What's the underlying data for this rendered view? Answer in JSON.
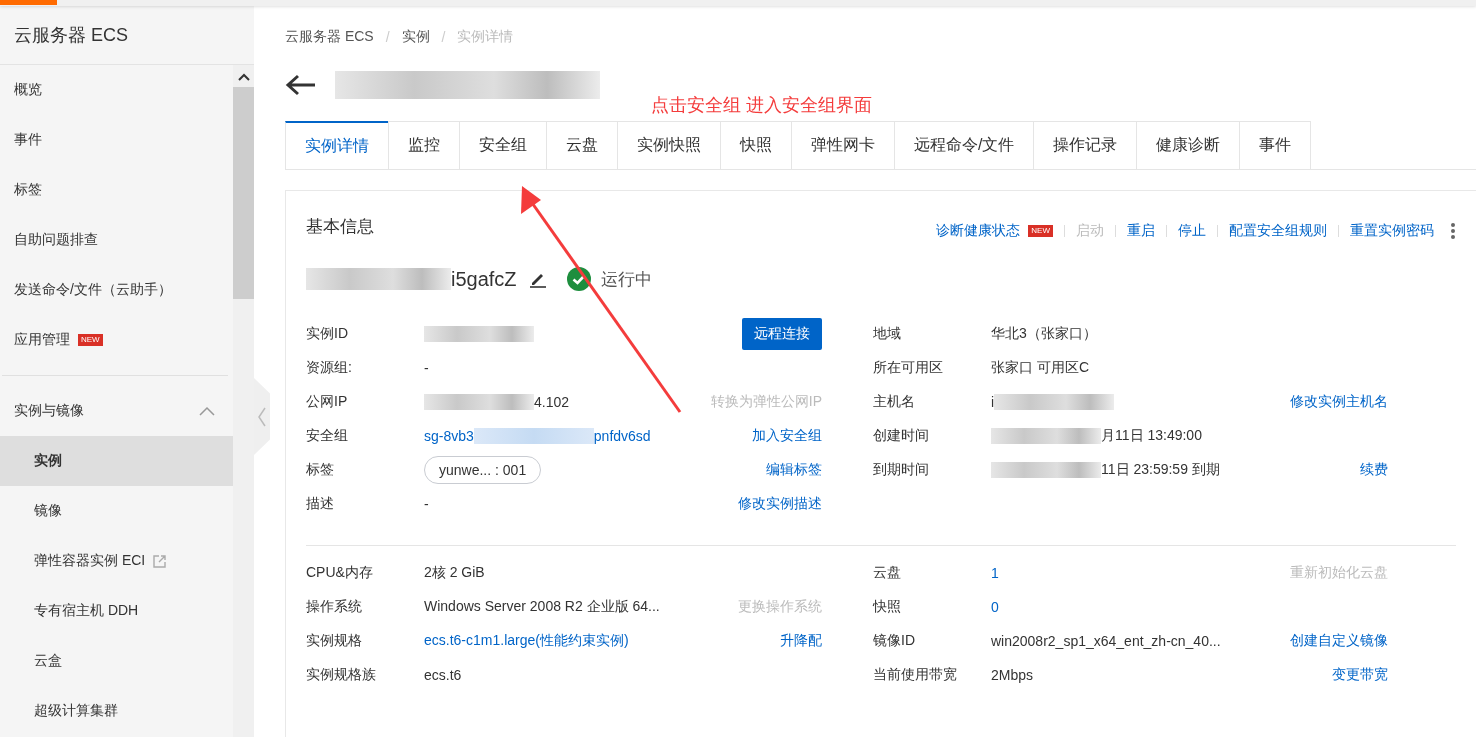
{
  "sidebar": {
    "title": "云服务器 ECS",
    "items": [
      {
        "label": "概览",
        "selected": false
      },
      {
        "label": "事件",
        "selected": false
      },
      {
        "label": "标签",
        "selected": false
      },
      {
        "label": "自助问题排查",
        "selected": false
      },
      {
        "label": "发送命令/文件（云助手）",
        "selected": false
      },
      {
        "label": "应用管理",
        "selected": false,
        "badge": "NEW"
      }
    ],
    "groups": [
      {
        "label": "实例与镜像",
        "expanded": true,
        "children": [
          {
            "label": "实例",
            "selected": true
          },
          {
            "label": "镜像",
            "selected": false
          },
          {
            "label": "弹性容器实例 ECI",
            "selected": false,
            "external": true
          },
          {
            "label": "专有宿主机 DDH",
            "selected": false
          },
          {
            "label": "云盒",
            "selected": false
          },
          {
            "label": "超级计算集群",
            "selected": false
          }
        ]
      }
    ]
  },
  "breadcrumb": [
    {
      "label": "云服务器 ECS",
      "current": false
    },
    {
      "separator": "/",
      "label": "实例",
      "current": false
    },
    {
      "separator": "/",
      "label": "实例详情",
      "current": true
    }
  ],
  "annotation": {
    "text": "点击安全组 进入安全组界面"
  },
  "tabs": [
    {
      "label": "实例详情",
      "selected": true
    },
    {
      "label": "监控",
      "selected": false
    },
    {
      "label": "安全组",
      "selected": false
    },
    {
      "label": "云盘",
      "selected": false
    },
    {
      "label": "实例快照",
      "selected": false
    },
    {
      "label": "快照",
      "selected": false
    },
    {
      "label": "弹性网卡",
      "selected": false
    },
    {
      "label": "远程命令/文件",
      "selected": false
    },
    {
      "label": "操作记录",
      "selected": false
    },
    {
      "label": "健康诊断",
      "selected": false
    },
    {
      "label": "事件",
      "selected": false
    }
  ],
  "basic_info": {
    "title": "基本信息",
    "actions": [
      {
        "label": "诊断健康状态",
        "badge": "NEW",
        "disabled": false
      },
      {
        "label": "启动",
        "disabled": true
      },
      {
        "label": "重启",
        "disabled": false
      },
      {
        "label": "停止",
        "disabled": false
      },
      {
        "label": "配置安全组规则",
        "disabled": false
      },
      {
        "label": "重置实例密码",
        "disabled": false
      }
    ],
    "instance_name": "i5gafcZ",
    "status": "运行中",
    "sections": [
      {
        "rows": [
          {
            "label": "实例ID",
            "value": [
              {
                "kind": "blur"
              }
            ],
            "kind": "text",
            "action": {
              "label": "远程连接",
              "kind": "button",
              "disabled": false
            }
          },
          {
            "label": "地域",
            "value": [
              {
                "kind": "text",
                "text": "华北3（张家口）"
              }
            ],
            "kind": "text"
          },
          {
            "label": "资源组:",
            "value": [
              {
                "kind": "text",
                "text": "-"
              }
            ],
            "kind": "text"
          },
          {
            "label": "所在可用区",
            "value": [
              {
                "kind": "text",
                "text": "张家口 可用区C"
              }
            ],
            "kind": "text"
          },
          {
            "label": "公网IP",
            "value": [
              {
                "kind": "blur"
              },
              {
                "kind": "text",
                "text": "4.102"
              }
            ],
            "kind": "text",
            "action": {
              "label": "转换为弹性公网IP",
              "kind": "link",
              "disabled": true
            }
          },
          {
            "label": "主机名",
            "value": [
              {
                "kind": "text",
                "text": "i"
              },
              {
                "kind": "blur"
              }
            ],
            "kind": "text",
            "action": {
              "label": "修改实例主机名",
              "kind": "link",
              "disabled": false
            }
          },
          {
            "label": "安全组",
            "value": [
              {
                "kind": "text",
                "text": "sg-8vb3"
              },
              {
                "kind": "blur"
              },
              {
                "kind": "text",
                "text": "pnfdv6sd"
              }
            ],
            "kind": "link",
            "action": {
              "label": "加入安全组",
              "kind": "link",
              "disabled": false
            }
          },
          {
            "label": "创建时间",
            "value": [
              {
                "kind": "blur"
              },
              {
                "kind": "text",
                "text": "月11日 13:49:00"
              }
            ],
            "kind": "text"
          },
          {
            "label": "标签",
            "value": [
              {
                "kind": "text",
                "text": "yunwe... : 001"
              }
            ],
            "kind": "tag",
            "action": {
              "label": "编辑标签",
              "kind": "link",
              "disabled": false
            }
          },
          {
            "label": "到期时间",
            "value": [
              {
                "kind": "blur"
              },
              {
                "kind": "text",
                "text": "11日 23:59:59 到期"
              }
            ],
            "kind": "text",
            "action": {
              "label": "续费",
              "kind": "link",
              "disabled": false
            }
          },
          {
            "label": "描述",
            "value": [
              {
                "kind": "text",
                "text": "-"
              }
            ],
            "kind": "text",
            "action": {
              "label": "修改实例描述",
              "kind": "link",
              "disabled": false
            }
          }
        ]
      },
      {
        "rows": [
          {
            "label": "CPU&内存",
            "value": [
              {
                "kind": "text",
                "text": "2核 2 GiB"
              }
            ],
            "kind": "text"
          },
          {
            "label": "云盘",
            "value": [
              {
                "kind": "text",
                "text": "1"
              }
            ],
            "kind": "link",
            "action": {
              "label": "重新初始化云盘",
              "kind": "link",
              "disabled": true
            }
          },
          {
            "label": "操作系统",
            "value": [
              {
                "kind": "text",
                "text": "Windows Server 2008 R2 企业版 64..."
              }
            ],
            "kind": "text",
            "action": {
              "label": "更换操作系统",
              "kind": "link",
              "disabled": true
            }
          },
          {
            "label": "快照",
            "value": [
              {
                "kind": "text",
                "text": "0"
              }
            ],
            "kind": "link"
          },
          {
            "label": "实例规格",
            "value": [
              {
                "kind": "text",
                "text": "ecs.t6-c1m1.large(性能约束实例)"
              }
            ],
            "kind": "link",
            "action": {
              "label": "升降配",
              "kind": "link",
              "disabled": false
            }
          },
          {
            "label": "镜像ID",
            "value": [
              {
                "kind": "text",
                "text": "win2008r2_sp1_x64_ent_zh-cn_40..."
              }
            ],
            "kind": "text",
            "action": {
              "label": "创建自定义镜像",
              "kind": "link",
              "disabled": false
            }
          },
          {
            "label": "实例规格族",
            "value": [
              {
                "kind": "text",
                "text": "ecs.t6"
              }
            ],
            "kind": "text"
          },
          {
            "label": "当前使用带宽",
            "value": [
              {
                "kind": "text",
                "text": "2Mbps"
              }
            ],
            "kind": "text",
            "action": {
              "label": "变更带宽",
              "kind": "link",
              "disabled": false
            }
          }
        ]
      }
    ]
  }
}
